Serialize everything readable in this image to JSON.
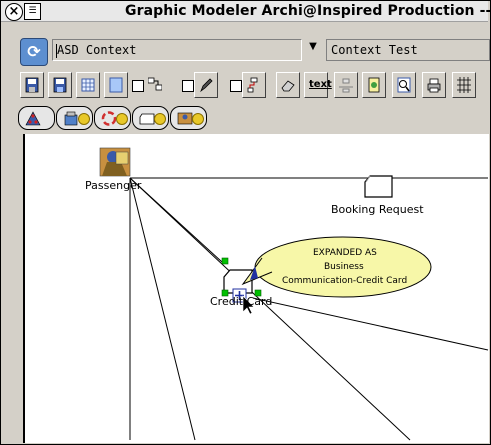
{
  "window": {
    "title": "Graphic Modeler Archi@Inspired Production --",
    "close_glyph": "×",
    "menu_glyph": "☰"
  },
  "context_bar": {
    "context_value": "ASD Context",
    "second_value": "Context Test",
    "dropdown_glyph": "▼"
  },
  "toolbar": {
    "text_tool_label": "text",
    "buttons": [
      "save-icon",
      "save-as-icon",
      "grid-icon",
      "new-page-icon",
      "link-icon",
      "pencil-icon",
      "connector-icon",
      "eraser-icon",
      "text-tool",
      "flow-icon",
      "document-icon",
      "find-icon",
      "print-icon",
      "grid-view-icon"
    ]
  },
  "tabs": [
    "org-chart-tab",
    "building-tab",
    "process-tab",
    "shape-tab",
    "actor-tab"
  ],
  "diagram": {
    "nodes": {
      "passenger": "Passenger",
      "booking_request": "Booking Request",
      "credit_card": "Credit Card"
    },
    "tooltip": {
      "line1": "EXPANDED AS",
      "line2": "Business",
      "line3": "Communication-Credit Card"
    }
  },
  "colors": {
    "tooltip_fill": "#f7f7a8",
    "selection_handle": "#00c000",
    "canvas_bg": "#ffffff"
  }
}
